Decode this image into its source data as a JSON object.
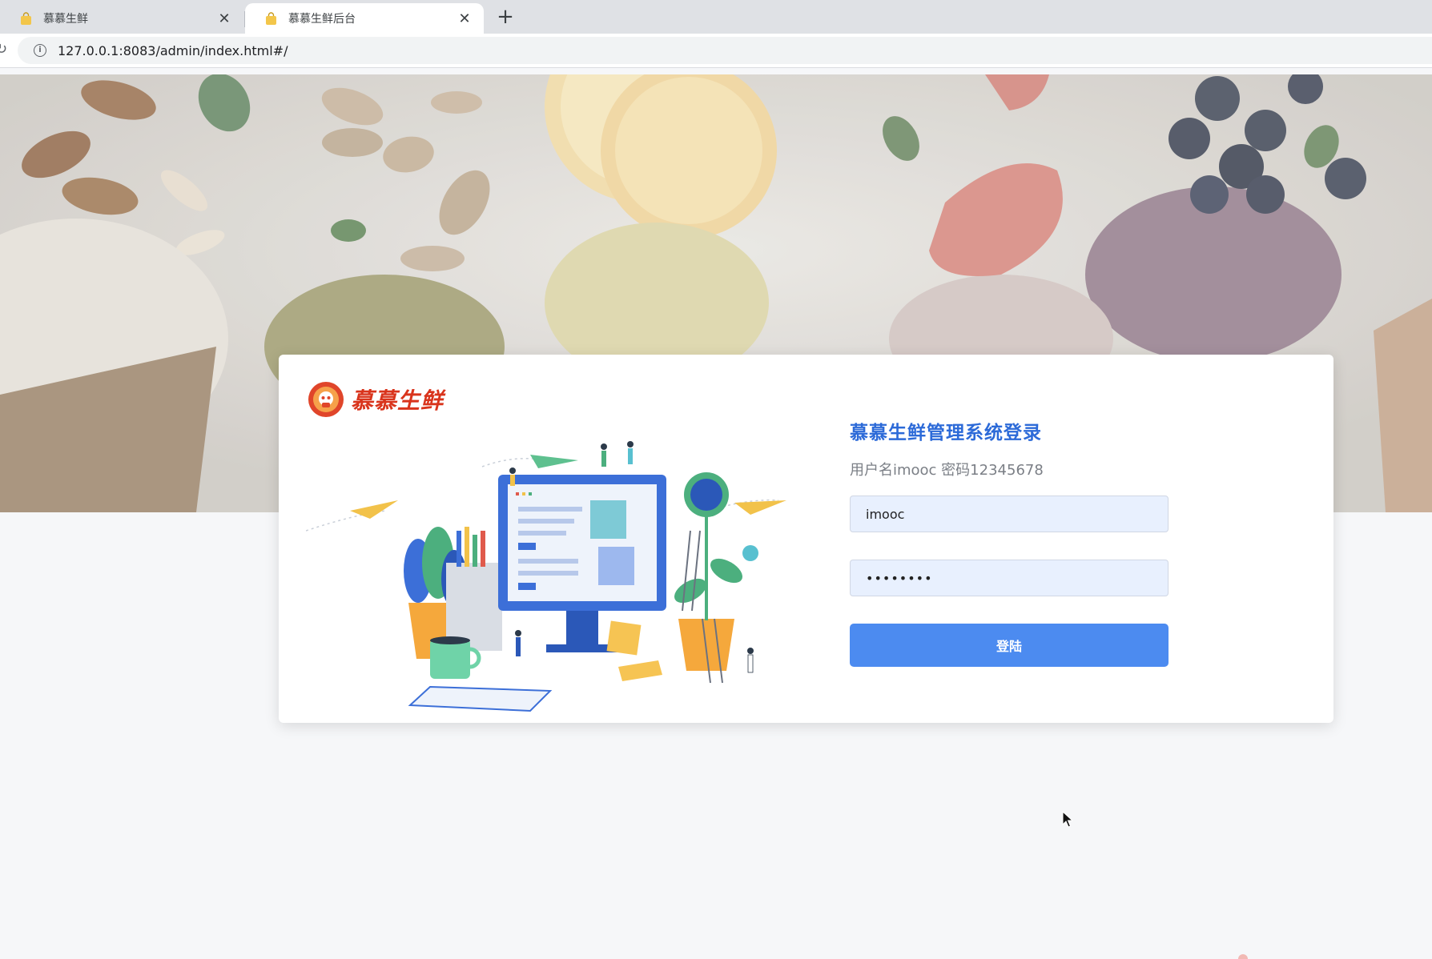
{
  "browser": {
    "tabs": [
      {
        "title": "慕慕生鲜",
        "active": false
      },
      {
        "title": "慕慕生鲜后台",
        "active": true
      }
    ],
    "new_tab_icon": "plus-icon",
    "url": "127.0.0.1:8083/admin/index.html#/"
  },
  "brand": {
    "name": "慕慕生鲜",
    "logo_color": "#d9341c"
  },
  "login": {
    "title": "慕慕生鲜管理系统登录",
    "hint": "用户名imooc 密码12345678",
    "username_value": "imooc",
    "password_value": "••••••••",
    "submit_label": "登陆"
  },
  "colors": {
    "accent": "#4c8bf0",
    "title_blue": "#2c6ad8",
    "input_bg": "#e8f0fe"
  }
}
